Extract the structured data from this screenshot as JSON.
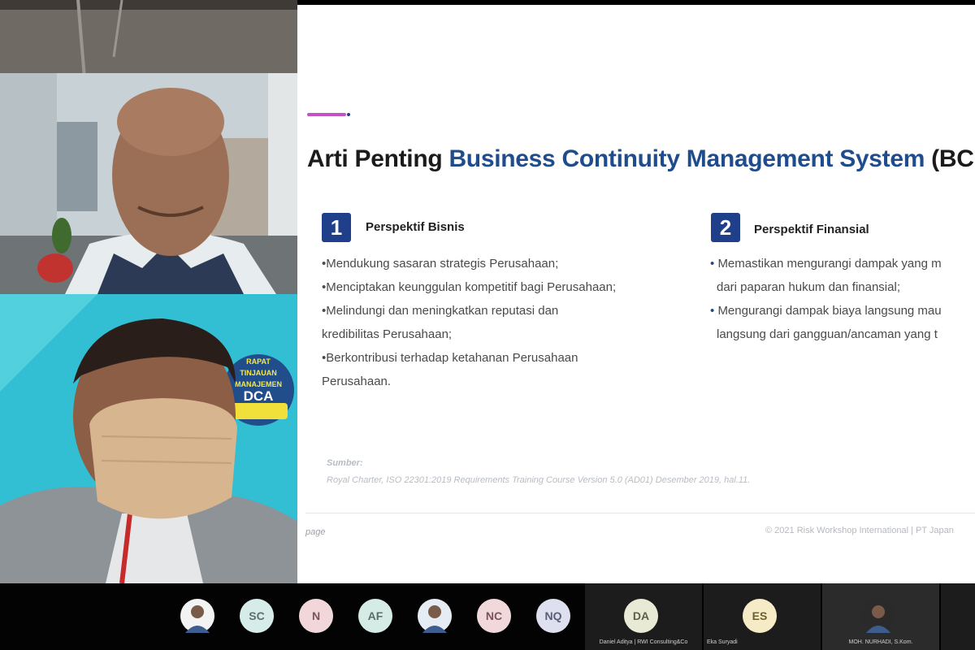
{
  "slide": {
    "title_prefix": "Arti Penting ",
    "title_highlight": "Business Continuity Management System",
    "title_suffix": " (BC",
    "left": {
      "number": "1",
      "heading": "Perspektif Bisnis",
      "bullets": [
        "•Mendukung sasaran strategis Perusahaan;",
        "•Menciptakan keunggulan kompetitif bagi Perusahaan;",
        "•Melindungi dan meningkatkan reputasi dan",
        "kredibilitas Perusahaan;",
        "•Berkontribusi terhadap ketahanan Perusahaan",
        "Perusahaan."
      ]
    },
    "right": {
      "number": "2",
      "heading": "Perspektif Finansial",
      "bullet_1_line_1": "Memastikan mengurangi dampak yang m",
      "bullet_1_line_2": "dari paparan hukum dan finansial;",
      "bullet_2_line_1": "Mengurangi dampak biaya langsung mau",
      "bullet_2_line_2": "langsung dari gangguan/ancaman yang t"
    },
    "source_label": "Sumber:",
    "source_text": "Royal Charter, ISO 22301:2019 Requirements Training Course Version 5.0 (AD01) Desember 2019, hal.11.",
    "footer_page": "page",
    "footer_copyright": "© 2021 Risk Workshop International | PT Japan"
  },
  "video_tiles": {
    "banner_lines": [
      "RAPAT",
      "TINJAUAN",
      "MANAJEMEN",
      "DCA"
    ]
  },
  "participants": [
    {
      "initials": "",
      "bg": "#f3f3f3",
      "fg": "#333",
      "type": "photo"
    },
    {
      "initials": "SC",
      "bg": "#d6ece8",
      "fg": "#5f6f6a"
    },
    {
      "initials": "N",
      "bg": "#f1d7d9",
      "fg": "#7a5558"
    },
    {
      "initials": "AF",
      "bg": "#d4ebe6",
      "fg": "#5b6e69"
    },
    {
      "initials": "",
      "bg": "#e6ecf4",
      "fg": "#333",
      "type": "photo"
    },
    {
      "initials": "NC",
      "bg": "#f1d8da",
      "fg": "#7a5558"
    },
    {
      "initials": "NQ",
      "bg": "#dfe0ef",
      "fg": "#5a5c78"
    },
    {
      "initials": "DA",
      "bg": "#e9ead6",
      "fg": "#5f6045",
      "caption": "Daniel Aditya | RWI Consulting&Co"
    },
    {
      "initials": "ES",
      "bg": "#f6ebc7",
      "fg": "#6c5f32",
      "caption": "Eka Suryadi"
    },
    {
      "initials": "",
      "bg": "#2a2a2a",
      "fg": "#eee",
      "type": "photo",
      "caption": "MOH. NURHADI, S.Kom."
    }
  ]
}
